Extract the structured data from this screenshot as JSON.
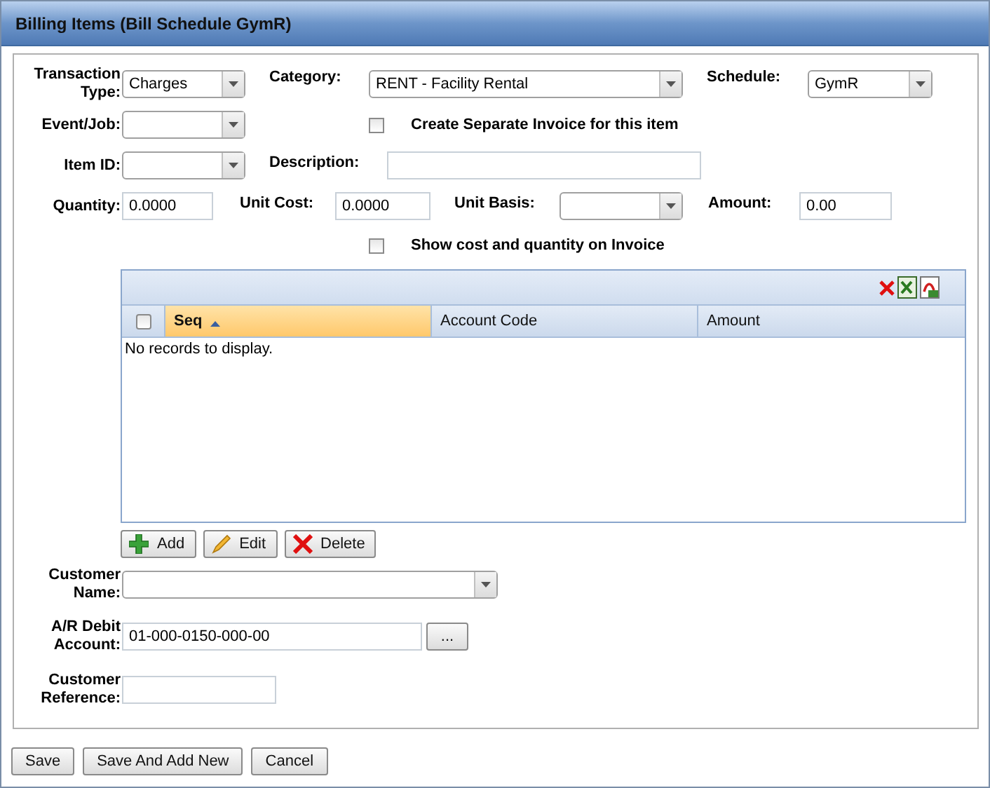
{
  "window": {
    "title": "Billing Items (Bill Schedule GymR)"
  },
  "form": {
    "transaction_type": {
      "label": "Transaction Type:",
      "value": "Charges"
    },
    "category": {
      "label": "Category:",
      "value": "RENT - Facility Rental"
    },
    "schedule": {
      "label": "Schedule:",
      "value": "GymR"
    },
    "event_job": {
      "label": "Event/Job:"
    },
    "separate_invoice": {
      "label": "Create Separate Invoice for this item",
      "checked": false
    },
    "item_id": {
      "label": "Item ID:"
    },
    "description": {
      "label": "Description:"
    },
    "quantity": {
      "label": "Quantity:",
      "value": "0.0000"
    },
    "unit_cost": {
      "label": "Unit Cost:",
      "value": "0.0000"
    },
    "unit_basis": {
      "label": "Unit Basis:"
    },
    "amount": {
      "label": "Amount:",
      "value": "0.00"
    },
    "show_cost": {
      "label": "Show cost and quantity on Invoice",
      "checked": false
    }
  },
  "grid": {
    "select_all_checked": false,
    "columns": [
      {
        "label": "Seq",
        "sorted": true
      },
      {
        "label": "Account Code",
        "sorted": false
      },
      {
        "label": "Amount",
        "sorted": false
      }
    ],
    "empty_message": "No records to display.",
    "buttons": [
      {
        "kind": "add",
        "label": "Add"
      },
      {
        "kind": "edit",
        "label": "Edit"
      },
      {
        "kind": "delete",
        "label": "Delete"
      }
    ]
  },
  "customer_name": {
    "label": "Customer Name:"
  },
  "ar_debit_account": {
    "label": "A/R Debit Account:",
    "value": "01-000-0150-000-00",
    "button": "..."
  },
  "customer_reference": {
    "label": "Customer Reference:"
  },
  "footer_buttons": [
    "Save",
    "Save And Add New",
    "Cancel"
  ]
}
